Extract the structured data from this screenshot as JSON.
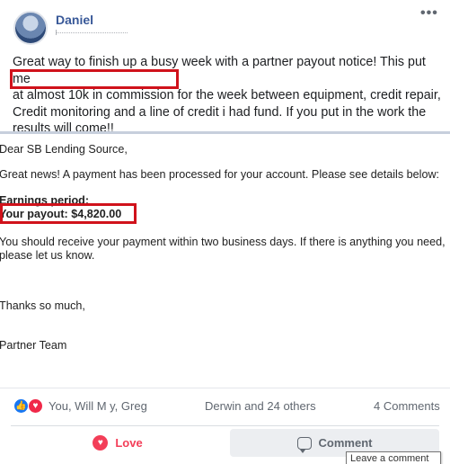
{
  "post": {
    "author": "Daniel",
    "text_lines": [
      "Great way to finish up a busy week with a partner payout notice! This put me",
      "at almost 10k in commission  for the week between equipment, credit repair,",
      "Credit monitoring and a line of credit i had fund. If you put in the work the",
      "results will come!!"
    ]
  },
  "letter": {
    "greeting": "Dear SB Lending Source,",
    "line1": "Great news!  A payment has been processed for your account.  Please see details below:",
    "earnings_label": "Earnings period:",
    "payout": "Your payout: $4,820.00",
    "line2a": "You should receive your payment within two business days.  If there is anything you need,",
    "line2b": "please let us know.",
    "thanks": "Thanks so much,",
    "signature": "Partner Team"
  },
  "reactions": {
    "names_part1": "You, Will M     y, Greg",
    "names_part2": "Derwin and 24 others",
    "comments": "4 Comments"
  },
  "actions": {
    "love_label": "Love",
    "comment_label": "Comment",
    "tooltip": "Leave a comment"
  },
  "colors": {
    "highlight_border": "#d0121b",
    "love": "#f33e58",
    "like": "#1877f2",
    "author": "#385898"
  },
  "icons": [
    "more-options-icon",
    "like-reaction-icon",
    "love-reaction-icon",
    "love-icon",
    "comment-icon"
  ]
}
